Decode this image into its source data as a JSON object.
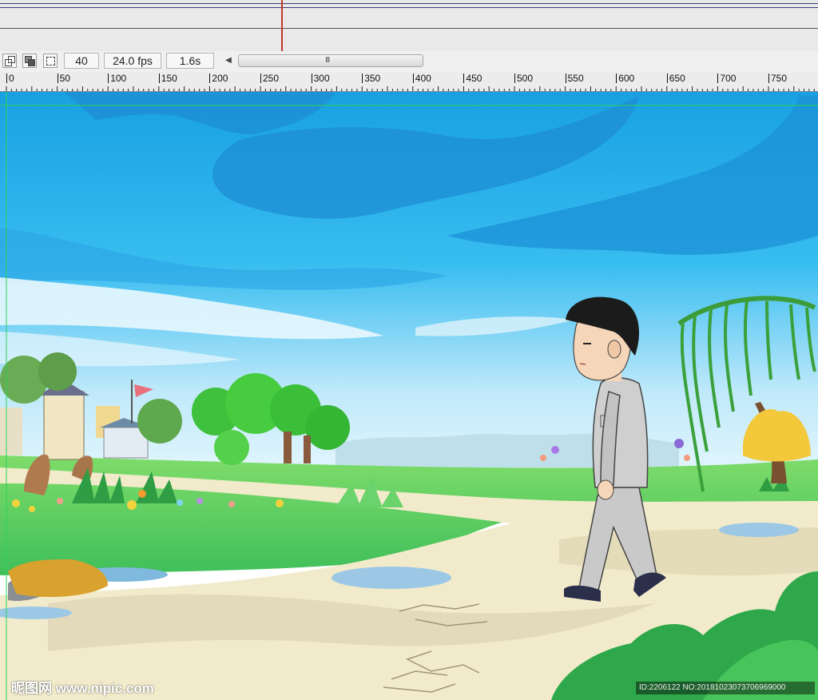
{
  "status_bar": {
    "frame": "40",
    "fps": "24.0 fps",
    "time": "1.6s",
    "scroll_grip": "III",
    "scroll_left_arrow": "◀",
    "icons": [
      "onion-skin-icon",
      "onion-skin-outlines-icon",
      "edit-multiple-frames-icon"
    ]
  },
  "ruler": {
    "labels": [
      "0",
      "50",
      "100",
      "150",
      "200",
      "250",
      "300",
      "350",
      "400",
      "450",
      "500",
      "550",
      "600",
      "650",
      "700",
      "750"
    ]
  },
  "watermark": {
    "left": "昵图网 www.nipic.com",
    "right": "ID:2206122 NO:20181023073706969000"
  },
  "colors": {
    "sky_top": "#1a9fe0",
    "sky_bottom": "#c9eefb",
    "grass": "#5ccf63",
    "path": "#f3eccd",
    "playhead": "#c0392b"
  }
}
